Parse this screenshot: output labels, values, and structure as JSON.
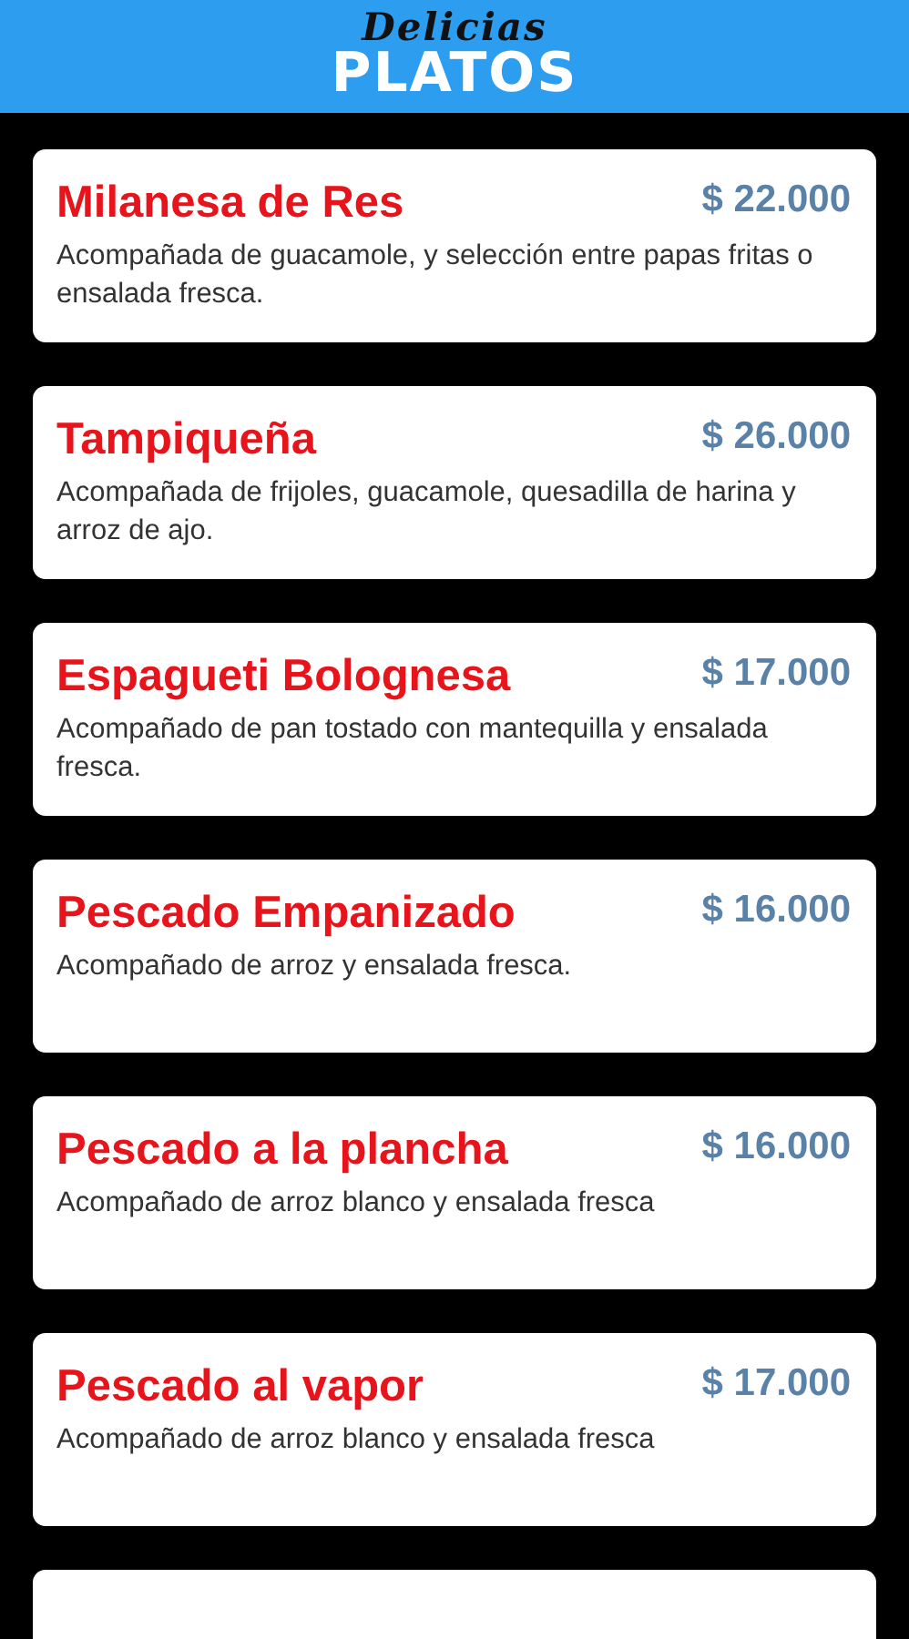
{
  "header": {
    "subtitle": "Delicias",
    "title": "PLATOS"
  },
  "dishes": [
    {
      "name": "Milanesa de Res",
      "price": "$ 22.000",
      "description": "Acompañada de guacamole, y selección entre papas fritas o ensalada fresca."
    },
    {
      "name": "Tampiqueña",
      "price": "$ 26.000",
      "description": "Acompañada de frijoles, guacamole, quesadilla de harina y arroz de ajo."
    },
    {
      "name": "Espagueti Bolognesa",
      "price": "$ 17.000",
      "description": "Acompañado de pan tostado con mantequilla y ensalada fresca."
    },
    {
      "name": "Pescado Empanizado",
      "price": "$ 16.000",
      "description": "Acompañado de arroz y ensalada fresca."
    },
    {
      "name": "Pescado a la plancha",
      "price": "$ 16.000",
      "description": "Acompañado de arroz blanco y ensalada fresca"
    },
    {
      "name": "Pescado al vapor",
      "price": "$ 17.000",
      "description": "Acompañado de arroz blanco y ensalada fresca"
    }
  ],
  "more_below": true
}
